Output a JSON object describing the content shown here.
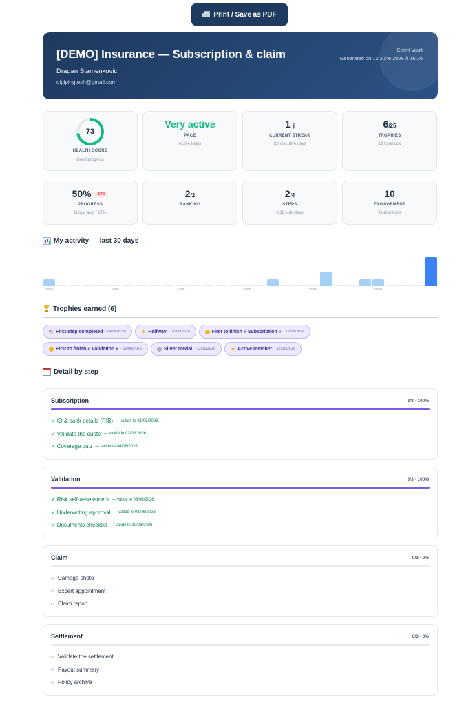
{
  "print_button": {
    "label": "Print / Save as PDF",
    "icon": "printer-icon"
  },
  "hero": {
    "title": "[DEMO] Insurance — Subscription & claim",
    "name": "Dragan Stamenkovic",
    "email": "digipingtech@gmail.com",
    "vault_label": "Client Vault",
    "generated": "Generated on 12 June 2026 à 16:26"
  },
  "kpis_row1": {
    "health": {
      "value": "73",
      "fraction": 0.73,
      "label": "HEALTH SCORE",
      "sub": "Good progress"
    },
    "pace": {
      "value": "Very active",
      "label": "PACE",
      "sub": "Active today"
    },
    "streak": {
      "value": "1",
      "unit": "j",
      "label": "CURRENT STREAK",
      "sub": "Consecutive days"
    },
    "trophies": {
      "value": "6",
      "unit": "/25",
      "label": "TROPHIES",
      "sub": "19 to unlock"
    }
  },
  "kpis_row2": {
    "progress": {
      "value": "50%",
      "delta": "-17%",
      "label": "PROGRESS",
      "sub": "Group avg. : 67%"
    },
    "ranking": {
      "value": "2",
      "unit": "/2",
      "label": "RANKING",
      "sub": ""
    },
    "steps": {
      "value": "2",
      "unit": "/4",
      "label": "STEPS",
      "sub": "6/12 sub-steps"
    },
    "engagement": {
      "value": "10",
      "label": "ENGAGEMENT",
      "sub": "Total actions"
    }
  },
  "activity": {
    "heading": "My activity — last 30 days",
    "icon": "bar-chart-icon",
    "tick_labels": [
      "14/05",
      "19/05",
      "24/05",
      "29/05",
      "03/06",
      "08/06"
    ]
  },
  "chart_data": {
    "type": "bar",
    "title": "",
    "xlabel": "",
    "ylabel": "",
    "categories": [
      "14/05",
      "15/05",
      "16/05",
      "17/05",
      "18/05",
      "19/05",
      "20/05",
      "21/05",
      "22/05",
      "23/05",
      "24/05",
      "25/05",
      "26/05",
      "27/05",
      "28/05",
      "29/05",
      "30/05",
      "31/05",
      "01/06",
      "02/06",
      "03/06",
      "04/06",
      "05/06",
      "06/06",
      "07/06",
      "08/06",
      "09/06",
      "10/06",
      "11/06",
      "12/06"
    ],
    "values": [
      1,
      0,
      0,
      0,
      0,
      0,
      0,
      0,
      0,
      0,
      0,
      0,
      0,
      0,
      0,
      0,
      0,
      1,
      0,
      0,
      0,
      2,
      0,
      0,
      1,
      1,
      0,
      0,
      0,
      4
    ],
    "ylim": [
      0,
      4
    ]
  },
  "trophies": {
    "heading": "Trophies earned (6)",
    "icon": "trophy-icon",
    "items": [
      {
        "label": "First step completed",
        "date": "· 04/06/2026",
        "icon": "rocket-icon"
      },
      {
        "label": "Halfway",
        "date": "· 07/06/2026",
        "icon": "lightning-icon"
      },
      {
        "label": "First to finish « Subscription »",
        "date": "· 12/06/2026",
        "icon": "gold-medal-icon"
      },
      {
        "label": "First to finish « Validation »",
        "date": "· 12/06/2026",
        "icon": "gold-medal-icon"
      },
      {
        "label": "Silver medal",
        "date": "· 12/06/2026",
        "icon": "silver-medal-icon"
      },
      {
        "label": "Active member",
        "date": "· 12/06/2026",
        "icon": "star-icon"
      }
    ]
  },
  "detail": {
    "heading": "Detail by step",
    "icon": "calendar-icon",
    "steps": [
      {
        "title": "Subscription",
        "progress": "3/3 · 100%",
        "fraction": 1.0,
        "items": [
          {
            "label": "ID & bank details (RIB)",
            "validated": "— validé le 31/05/2026",
            "done": true
          },
          {
            "label": "Validate the quote",
            "validated": "— validé le 02/06/2026",
            "done": true
          },
          {
            "label": "Coverage quiz",
            "validated": "— validé le 04/06/2026",
            "done": true
          }
        ]
      },
      {
        "title": "Validation",
        "progress": "3/3 · 100%",
        "fraction": 1.0,
        "items": [
          {
            "label": "Risk self-assessment",
            "validated": "— validé le 06/06/2026",
            "done": true
          },
          {
            "label": "Underwriting approval",
            "validated": "— validé le 08/06/2026",
            "done": true
          },
          {
            "label": "Documents checklist",
            "validated": "— validé le 10/06/2026",
            "done": true
          }
        ]
      },
      {
        "title": "Claim",
        "progress": "0/3 · 0%",
        "fraction": 0.0,
        "items": [
          {
            "label": "Damage photo",
            "validated": "",
            "done": false
          },
          {
            "label": "Expert appointment",
            "validated": "",
            "done": false
          },
          {
            "label": "Claim report",
            "validated": "",
            "done": false
          }
        ]
      },
      {
        "title": "Settlement",
        "progress": "0/3 · 0%",
        "fraction": 0.0,
        "items": [
          {
            "label": "Validate the settlement",
            "validated": "",
            "done": false
          },
          {
            "label": "Payout summary",
            "validated": "",
            "done": false
          },
          {
            "label": "Policy archive",
            "validated": "",
            "done": false
          }
        ]
      }
    ]
  }
}
